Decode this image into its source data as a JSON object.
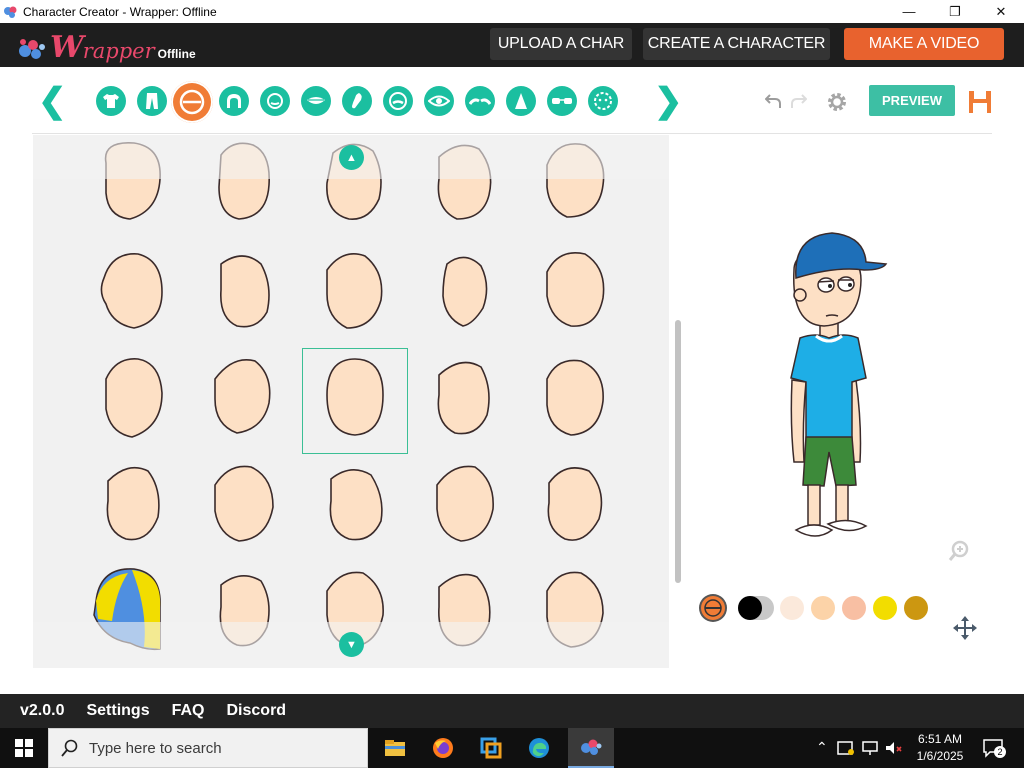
{
  "window": {
    "title": "Character Creator - Wrapper: Offline"
  },
  "header": {
    "logo_w": "W",
    "logo_rapper": "rapper",
    "logo_offline": "Offline",
    "upload_label": "UPLOAD A CHAR",
    "create_label": "CREATE A CHARACTER",
    "video_label": "MAKE A VIDEO"
  },
  "toolbar": {
    "categories": [
      {
        "icon": "shirt-icon"
      },
      {
        "icon": "pants-icon"
      },
      {
        "icon": "head-shape-icon"
      },
      {
        "icon": "hair-icon"
      },
      {
        "icon": "face-icon"
      },
      {
        "icon": "mouth-icon"
      },
      {
        "icon": "ear-icon"
      },
      {
        "icon": "facial-hair-icon"
      },
      {
        "icon": "eye-icon"
      },
      {
        "icon": "eyebrow-icon"
      },
      {
        "icon": "nose-icon"
      },
      {
        "icon": "glasses-icon"
      },
      {
        "icon": "mark-icon"
      }
    ],
    "active_category": 2,
    "preview_label": "PREVIEW"
  },
  "colors": {
    "accent": "#1bbfa0",
    "active": "#f07c36",
    "skin": "#fde0c5",
    "skin_outline": "#3a2a2a",
    "swatches": [
      "#000000",
      "#fbe9db",
      "#fcd3a8",
      "#f8bfa3",
      "#f2dd00",
      "#cc9711"
    ]
  },
  "gallery": {
    "rows": 5,
    "cols": 5,
    "selected_index": 12
  },
  "footer": {
    "version": "v2.0.0",
    "settings": "Settings",
    "faq": "FAQ",
    "discord": "Discord"
  },
  "taskbar": {
    "search_placeholder": "Type here to search",
    "time": "6:51 AM",
    "date": "1/6/2025",
    "notifications": "2"
  }
}
